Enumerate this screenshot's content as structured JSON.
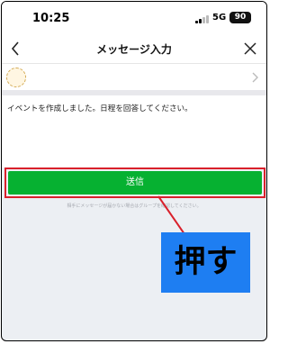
{
  "status": {
    "time": "10:25",
    "network": "5G",
    "battery": "90"
  },
  "header": {
    "title": "メッセージ入力",
    "back_icon": "chevron-left-icon",
    "close_icon": "close-icon"
  },
  "recipient": {
    "chevron_icon": "chevron-right-icon"
  },
  "message": {
    "text": "イベントを作成しました。日程を回答してください。"
  },
  "send": {
    "label": "送信"
  },
  "note": {
    "text": "相手にメッセージが届かない場合はグループを確認してください。"
  },
  "callout": {
    "text": "押す",
    "color": "#1e7ef2"
  },
  "colors": {
    "send": "#06b131",
    "highlight": "#d9202b"
  }
}
